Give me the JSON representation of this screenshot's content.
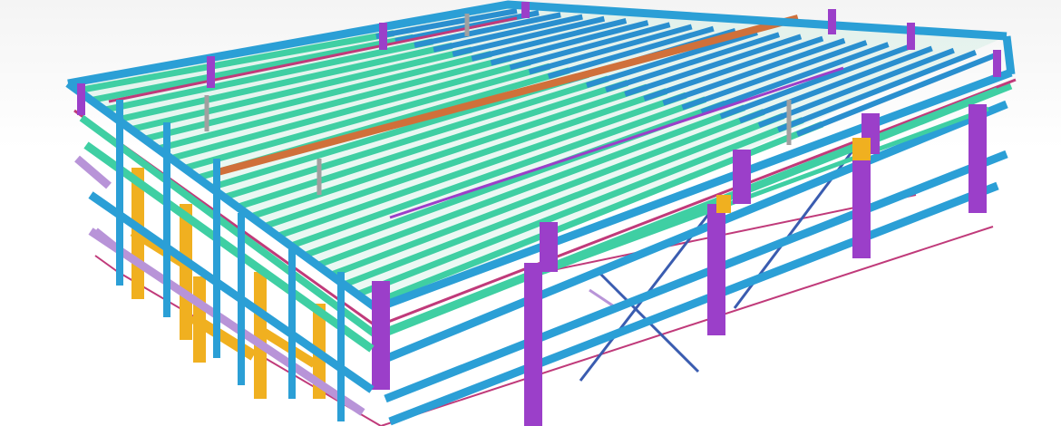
{
  "scene": {
    "subject": "steel-frame-building-3d-model",
    "background": "#ffffff"
  },
  "colors": {
    "edge_beam": "#2b9fd6",
    "column": "#9b3fc9",
    "purlin": "#3fcfa3",
    "purlin_blue": "#2a8fcf",
    "ridge_beam": "#d0703a",
    "gable_column": "#f0b020",
    "bracing": "#3a5cb0",
    "base_line": "#c03a7a",
    "lavender_member": "#b894d8",
    "grey_member": "#a0a0a0"
  }
}
